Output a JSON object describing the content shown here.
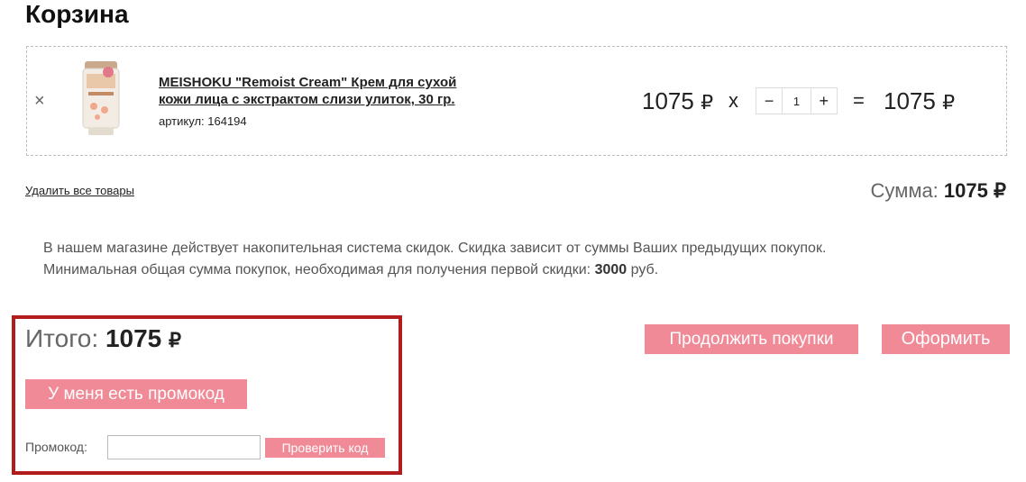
{
  "page": {
    "title": "Корзина"
  },
  "cart": {
    "item": {
      "remove_glyph": "×",
      "name_line1": "MEISHOKU \"Remoist Cream\" Крем для сухой",
      "name_line2": "кожи лица с экстрактом слизи улиток, 30 гр.",
      "sku_label": "артикул:",
      "sku_value": "164194",
      "unit_price": "1075",
      "times": "x",
      "quantity": "1",
      "minus": "−",
      "plus": "+",
      "equals": "=",
      "line_total": "1075",
      "currency": "₽"
    },
    "delete_all": "Удалить все товары",
    "sum_label": "Сумма:",
    "sum_value": "1075"
  },
  "notice": {
    "line1": "В нашем магазине действует накопительная система скидок. Скидка зависит от суммы Ваших предыдущих покупок.",
    "line2_prefix": "Минимальная общая сумма покупок, необходимая для получения первой скидки:",
    "line2_amount": "3000",
    "line2_suffix": "руб."
  },
  "total": {
    "label": "Итого:",
    "value": "1075",
    "currency": "₽"
  },
  "promo": {
    "toggle_button": "У меня есть промокод",
    "field_label": "Промокод:",
    "input_value": "",
    "check_button": "Проверить код"
  },
  "actions": {
    "continue_label": "Продолжить покупки",
    "checkout_label": "Оформить"
  },
  "colors": {
    "accent_pink": "#f08a97",
    "highlight_red": "#b31c1c"
  }
}
